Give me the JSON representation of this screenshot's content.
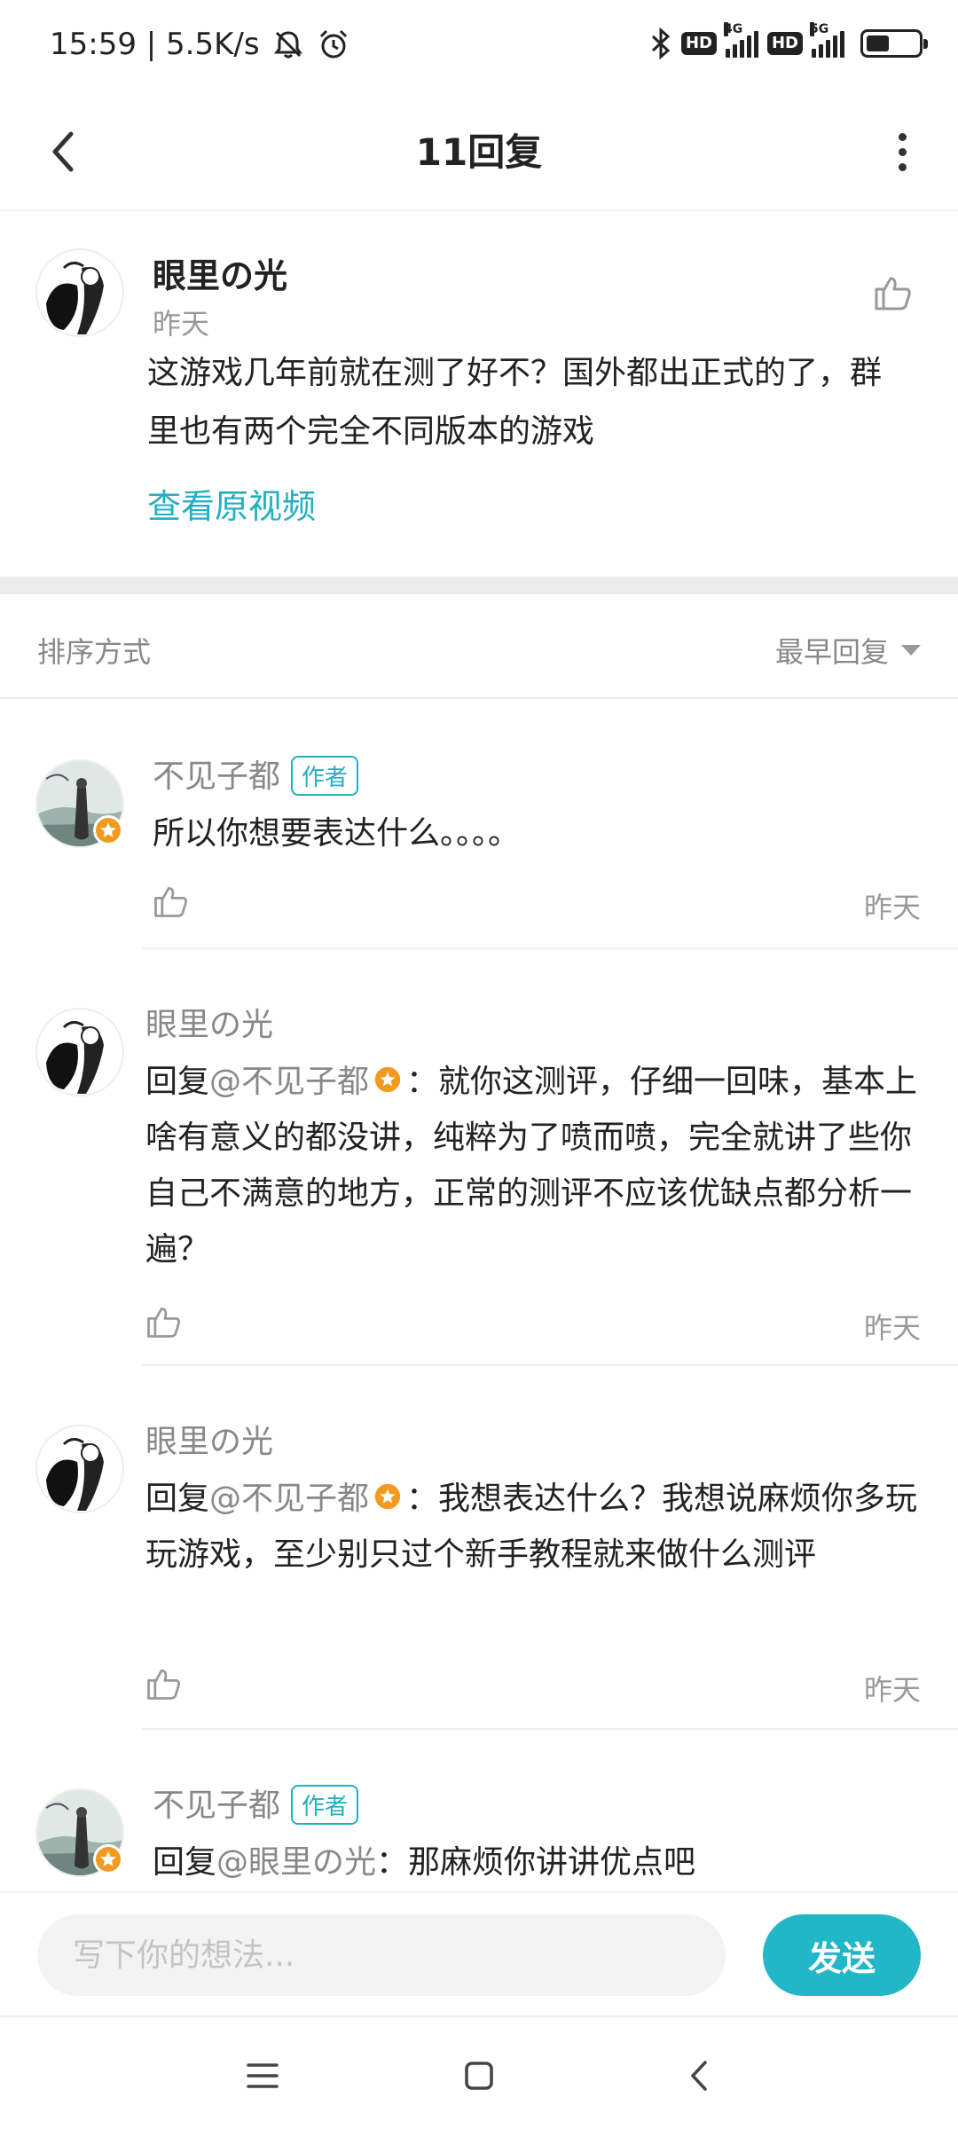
{
  "status_bar": {
    "time_speed": "15:59 | 5.5K/s",
    "hd1": "HD",
    "net1": "4G",
    "hd2": "HD",
    "net2": "5G",
    "battery_level": 0.45
  },
  "header": {
    "title": "11回复"
  },
  "main_comment": {
    "username": "眼里の光",
    "time": "昨天",
    "text": "这游戏几年前就在测了好不？国外都出正式的了，群里也有两个完全不同版本的游戏",
    "link": "查看原视频"
  },
  "sort": {
    "label": "排序方式",
    "selected": "最早回复"
  },
  "replies": [
    {
      "username": "不见子都",
      "tag": "作者",
      "text": "所以你想要表达什么。。。。",
      "time": "昨天"
    },
    {
      "username": "眼里の光",
      "prefix": "回复",
      "mention": "@不见子都",
      "text": "：就你这测评，仔细一回味，基本上啥有意义的都没讲，纯粹为了喷而喷，完全就讲了些你自己不满意的地方，正常的测评不应该优缺点都分析一遍？",
      "time": "昨天"
    },
    {
      "username": "眼里の光",
      "prefix": "回复",
      "mention": "@不见子都",
      "text": "：我想表达什么？我想说麻烦你多玩玩游戏，至少别只过个新手教程就来做什么测评",
      "time": "昨天"
    },
    {
      "username": "不见子都",
      "tag": "作者",
      "prefix": "回复",
      "mention": "@眼里の光",
      "text": "：那麻烦你讲讲优点吧"
    }
  ],
  "input": {
    "placeholder": "写下你的想法...",
    "send_label": "发送"
  }
}
